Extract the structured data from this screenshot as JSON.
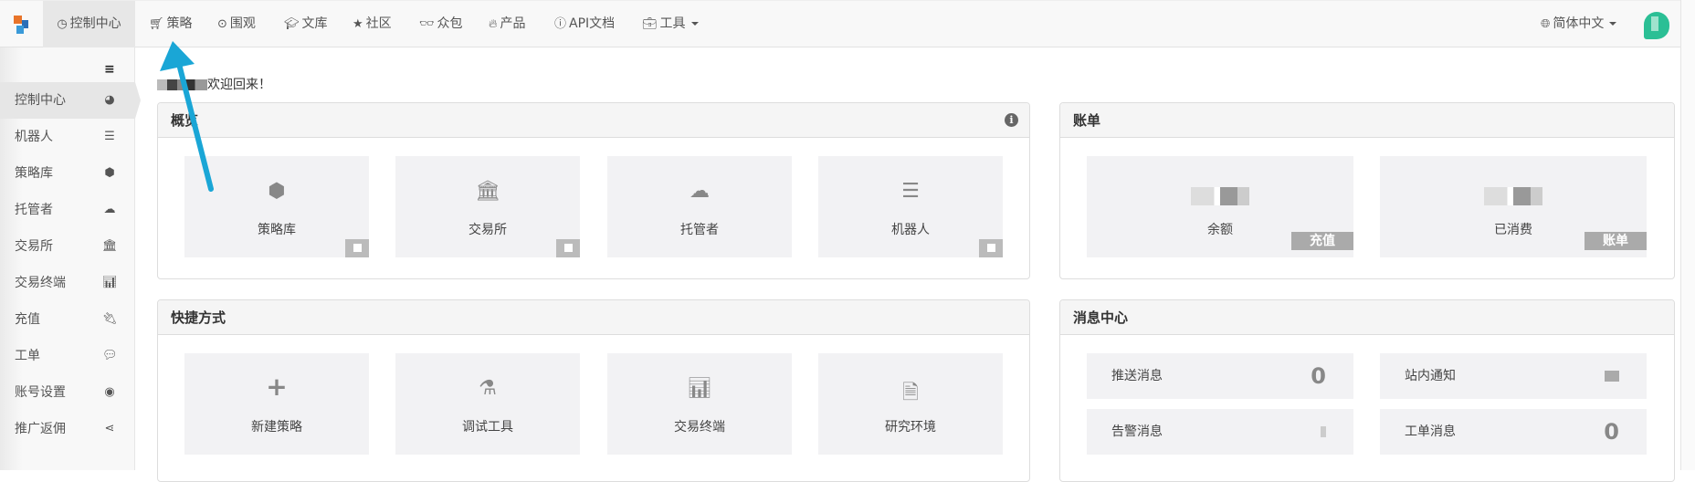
{
  "topnav": {
    "items": [
      {
        "label": "控制中心",
        "icon": "dashboard-icon",
        "active": true
      },
      {
        "label": "策略",
        "icon": "cart-icon"
      },
      {
        "label": "围观",
        "icon": "play-circle-icon"
      },
      {
        "label": "文库",
        "icon": "graduation-cap-icon"
      },
      {
        "label": "社区",
        "icon": "star-icon"
      },
      {
        "label": "众包",
        "icon": "glasses-icon"
      },
      {
        "label": "产品",
        "icon": "fire-icon"
      },
      {
        "label": "API文档",
        "icon": "info-circle-icon"
      },
      {
        "label": "工具",
        "icon": "briefcase-icon"
      }
    ],
    "language": "简体中文"
  },
  "sidebar": {
    "items": [
      {
        "label": "控制中心",
        "icon": "dashboard-icon",
        "active": true
      },
      {
        "label": "机器人",
        "icon": "server-icon"
      },
      {
        "label": "策略库",
        "icon": "cube-icon"
      },
      {
        "label": "托管者",
        "icon": "cloud-icon"
      },
      {
        "label": "交易所",
        "icon": "bank-icon"
      },
      {
        "label": "交易终端",
        "icon": "bar-chart-icon"
      },
      {
        "label": "充值",
        "icon": "plug-icon"
      },
      {
        "label": "工单",
        "icon": "comment-icon"
      },
      {
        "label": "账号设置",
        "icon": "user-circle-icon"
      },
      {
        "label": "推广返佣",
        "icon": "share-icon"
      }
    ]
  },
  "welcome": "欢迎回来！",
  "overview": {
    "title": "概览",
    "cards": [
      {
        "label": "策略库",
        "icon": "cube-icon"
      },
      {
        "label": "交易所",
        "icon": "bank-icon"
      },
      {
        "label": "托管者",
        "icon": "cloud-icon"
      },
      {
        "label": "机器人",
        "icon": "server-icon"
      }
    ]
  },
  "billing": {
    "title": "账单",
    "cards": [
      {
        "label": "余额",
        "button": "充值"
      },
      {
        "label": "已消费",
        "button": "账单"
      }
    ]
  },
  "shortcuts": {
    "title": "快捷方式",
    "cards": [
      {
        "label": "新建策略",
        "icon": "plus-icon"
      },
      {
        "label": "调试工具",
        "icon": "flask-icon"
      },
      {
        "label": "交易终端",
        "icon": "bar-chart-icon"
      },
      {
        "label": "研究环境",
        "icon": "code-file-icon"
      }
    ]
  },
  "messages": {
    "title": "消息中心",
    "items": [
      {
        "label": "推送消息",
        "value": "0"
      },
      {
        "label": "站内通知",
        "value": null
      },
      {
        "label": "告警消息",
        "value": null
      },
      {
        "label": "工单消息",
        "value": "0"
      }
    ]
  },
  "colors": {
    "annotation_arrow": "#1aa6d6",
    "avatar": "#2bbf95"
  }
}
